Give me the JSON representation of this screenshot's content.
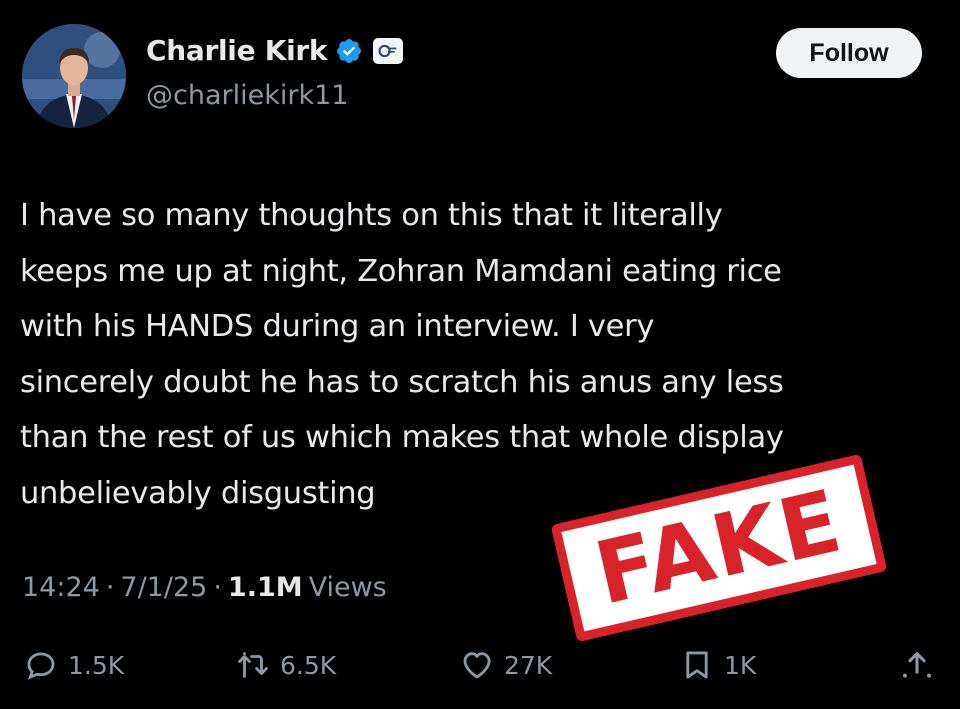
{
  "author": {
    "display_name": "Charlie Kirk",
    "handle": "@charliekirk11",
    "verified": true,
    "avatar_icon": "avatar-photo",
    "affiliate_icon": "affiliate-badge-icon"
  },
  "follow_label": "Follow",
  "tweet": {
    "text": "I have so many thoughts on this that it literally\nkeeps me up at night, Zohran Mamdani eating rice\nwith his HANDS during an interview. I very\nsincerely doubt he has to scratch his anus any less\nthan the rest of us which makes that whole display\nunbelievably disgusting"
  },
  "meta": {
    "time": "14:24",
    "separator": "·",
    "date": "7/1/25",
    "views_count": "1.1M",
    "views_label": "Views"
  },
  "stats": {
    "replies": "1.5K",
    "reposts": "6.5K",
    "likes": "27K",
    "bookmarks": "1K"
  },
  "stamp": {
    "text": "FAKE",
    "color": "#d8232a"
  },
  "colors": {
    "background": "#000000",
    "text_primary": "#e7e9ea",
    "text_secondary": "#8b98a5",
    "verified_blue": "#1d9bf0",
    "follow_bg": "#eff3f4"
  }
}
